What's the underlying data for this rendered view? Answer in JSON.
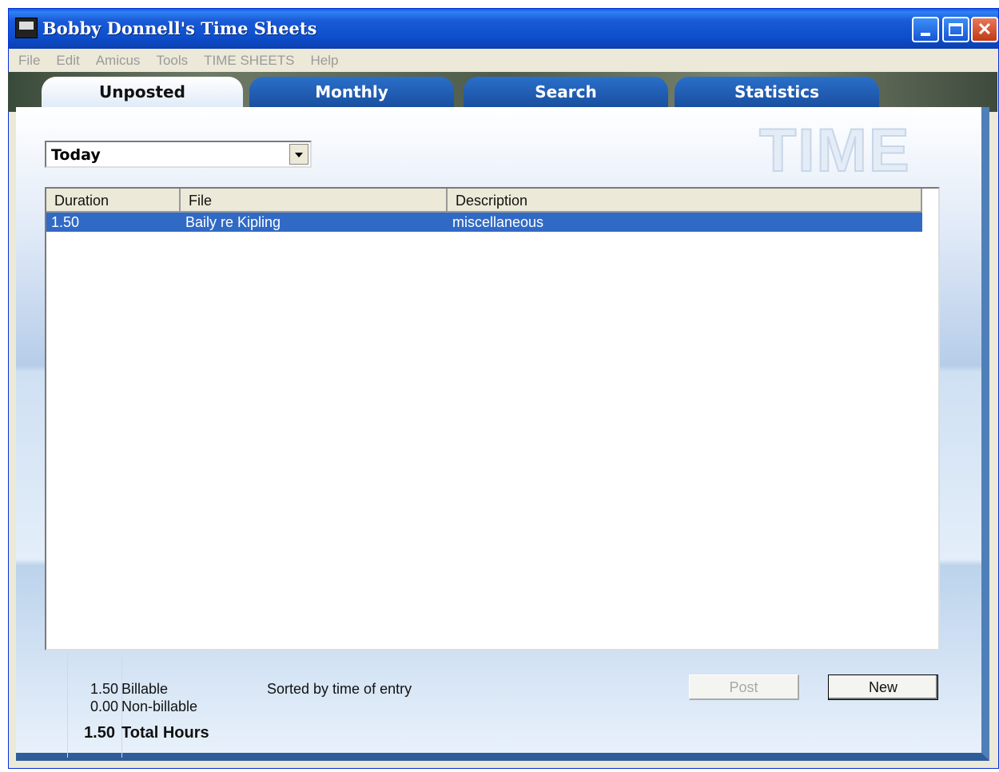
{
  "window": {
    "title": "Bobby Donnell's Time Sheets"
  },
  "menu": [
    "File",
    "Edit",
    "Amicus",
    "Tools",
    "TIME SHEETS",
    "Help"
  ],
  "tabs": [
    {
      "label": "Unposted",
      "active": true
    },
    {
      "label": "Monthly",
      "active": false
    },
    {
      "label": "Search",
      "active": false
    },
    {
      "label": "Statistics",
      "active": false
    }
  ],
  "logo_text": "TIME",
  "period_select": {
    "value": "Today"
  },
  "table": {
    "columns": [
      "Duration",
      "File",
      "Description"
    ],
    "rows": [
      {
        "duration": "1.50",
        "file": "Baily re Kipling",
        "description": "miscellaneous",
        "selected": true
      }
    ]
  },
  "summary": {
    "billable_value": "1.50",
    "billable_label": "Billable",
    "nonbillable_value": "0.00",
    "nonbillable_label": "Non-billable",
    "total_value": "1.50",
    "total_label": "Total Hours",
    "sort_text": "Sorted by time of entry"
  },
  "buttons": {
    "post": "Post",
    "new": "New"
  },
  "colors": {
    "selection": "#316ac5",
    "titlebar": "#0d4fcc",
    "tab_active": "#ffffff",
    "tab_inactive": "#1f5fb5"
  }
}
